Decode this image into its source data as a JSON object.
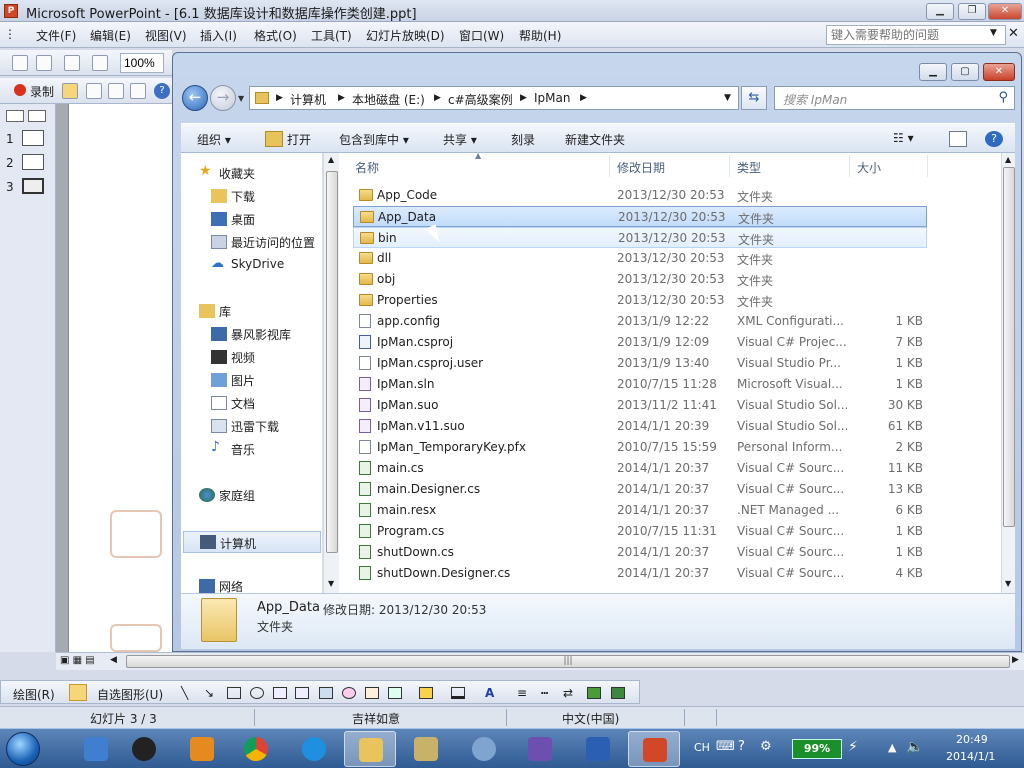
{
  "ppt": {
    "title": "Microsoft PowerPoint - [6.1 数据库设计和数据库操作类创建.ppt]",
    "menus": [
      "文件(F)",
      "编辑(E)",
      "视图(V)",
      "插入(I)",
      "格式(O)",
      "工具(T)",
      "幻灯片放映(D)",
      "窗口(W)",
      "帮助(H)"
    ],
    "help_placeholder": "键入需要帮助的问题",
    "zoom": "100%",
    "record_label": "录制",
    "slides": [
      "1",
      "2",
      "3"
    ],
    "seal_text": "吉祥如意",
    "draw_label": "绘图(R)",
    "autoshape_label": "自选图形(U)",
    "status": {
      "slide": "幻灯片 3 / 3",
      "design": "吉祥如意",
      "language": "中文(中国)"
    }
  },
  "explorer": {
    "breadcrumb": [
      "计算机",
      "本地磁盘 (E:)",
      "c#高级案例",
      "IpMan"
    ],
    "search_placeholder": "搜索 IpMan",
    "commands": [
      "组织",
      "打开",
      "包含到库中",
      "共享",
      "刻录",
      "新建文件夹"
    ],
    "nav": {
      "favorites": "收藏夹",
      "downloads": "下载",
      "desktop": "桌面",
      "recent": "最近访问的位置",
      "skydrive": "SkyDrive",
      "libraries": "库",
      "storm": "暴风影视库",
      "videos": "视频",
      "pictures": "图片",
      "documents": "文档",
      "thunder": "迅雷下载",
      "music": "音乐",
      "homegroup": "家庭组",
      "computer": "计算机",
      "network": "网络"
    },
    "columns": {
      "name": "名称",
      "date": "修改日期",
      "type": "类型",
      "size": "大小"
    },
    "files": [
      {
        "name": "App_Code",
        "date": "2013/12/30 20:53",
        "type": "文件夹",
        "size": "",
        "kind": "folder"
      },
      {
        "name": "App_Data",
        "date": "2013/12/30 20:53",
        "type": "文件夹",
        "size": "",
        "kind": "folder"
      },
      {
        "name": "bin",
        "date": "2013/12/30 20:53",
        "type": "文件夹",
        "size": "",
        "kind": "folder"
      },
      {
        "name": "dll",
        "date": "2013/12/30 20:53",
        "type": "文件夹",
        "size": "",
        "kind": "folder"
      },
      {
        "name": "obj",
        "date": "2013/12/30 20:53",
        "type": "文件夹",
        "size": "",
        "kind": "folder"
      },
      {
        "name": "Properties",
        "date": "2013/12/30 20:53",
        "type": "文件夹",
        "size": "",
        "kind": "folder"
      },
      {
        "name": "app.config",
        "date": "2013/1/9 12:22",
        "type": "XML Configurati...",
        "size": "1 KB",
        "kind": "file"
      },
      {
        "name": "IpMan.csproj",
        "date": "2013/1/9 12:09",
        "type": "Visual C# Projec...",
        "size": "7 KB",
        "kind": "proj"
      },
      {
        "name": "IpMan.csproj.user",
        "date": "2013/1/9 13:40",
        "type": "Visual Studio Pr...",
        "size": "1 KB",
        "kind": "file"
      },
      {
        "name": "IpMan.sln",
        "date": "2010/7/15 11:28",
        "type": "Microsoft Visual...",
        "size": "1 KB",
        "kind": "vs"
      },
      {
        "name": "IpMan.suo",
        "date": "2013/11/2 11:41",
        "type": "Visual Studio Sol...",
        "size": "30 KB",
        "kind": "vs"
      },
      {
        "name": "IpMan.v11.suo",
        "date": "2014/1/1 20:39",
        "type": "Visual Studio Sol...",
        "size": "61 KB",
        "kind": "vs"
      },
      {
        "name": "IpMan_TemporaryKey.pfx",
        "date": "2010/7/15 15:59",
        "type": "Personal Inform...",
        "size": "2 KB",
        "kind": "file"
      },
      {
        "name": "main.cs",
        "date": "2014/1/1 20:37",
        "type": "Visual C# Sourc...",
        "size": "11 KB",
        "kind": "cs"
      },
      {
        "name": "main.Designer.cs",
        "date": "2014/1/1 20:37",
        "type": "Visual C# Sourc...",
        "size": "13 KB",
        "kind": "cs"
      },
      {
        "name": "main.resx",
        "date": "2014/1/1 20:37",
        "type": ".NET Managed ...",
        "size": "6 KB",
        "kind": "cs"
      },
      {
        "name": "Program.cs",
        "date": "2010/7/15 11:31",
        "type": "Visual C# Sourc...",
        "size": "1 KB",
        "kind": "cs"
      },
      {
        "name": "shutDown.cs",
        "date": "2014/1/1 20:37",
        "type": "Visual C# Sourc...",
        "size": "1 KB",
        "kind": "cs"
      },
      {
        "name": "shutDown.Designer.cs",
        "date": "2014/1/1 20:37",
        "type": "Visual C# Sourc...",
        "size": "4 KB",
        "kind": "cs"
      }
    ],
    "details": {
      "name": "App_Data",
      "meta": "修改日期: 2013/12/30 20:53",
      "type": "文件夹"
    }
  },
  "taskbar": {
    "ime": "CH",
    "battery": "99%",
    "time": "20:49",
    "date": "2014/1/1"
  }
}
